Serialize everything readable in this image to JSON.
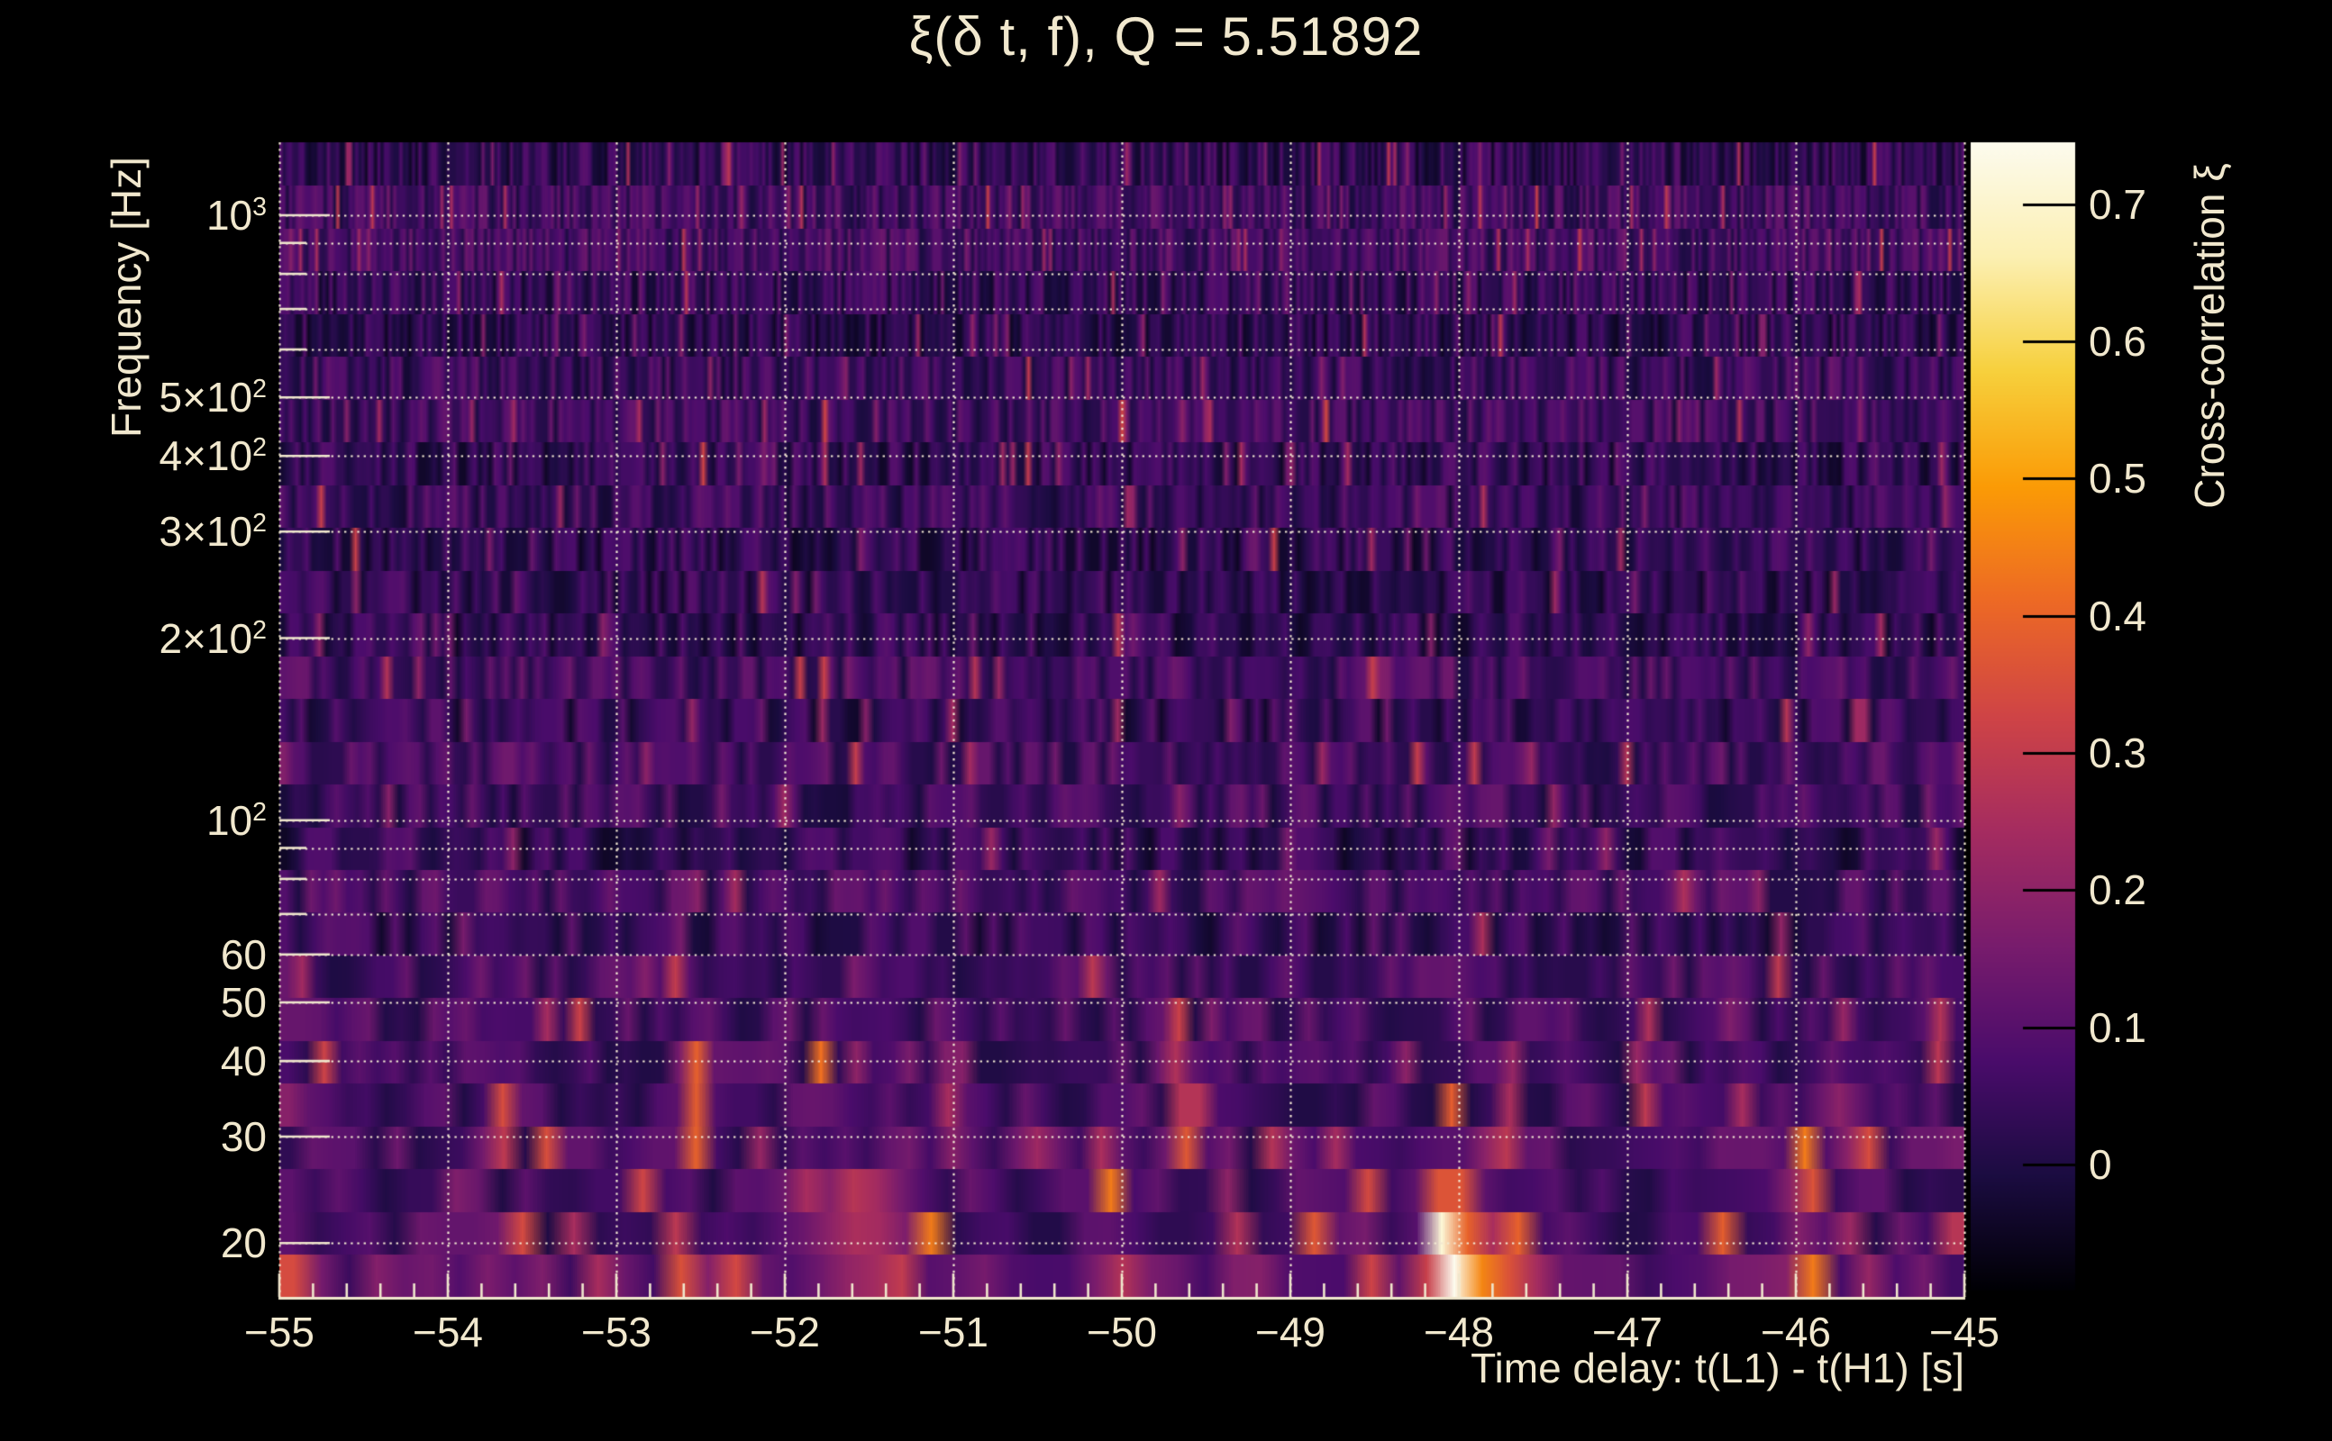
{
  "colors": {
    "background": "#000000",
    "text": "#f1e8ce",
    "axis_line": "#f0e7cd",
    "grid_dots": "#f3ead3",
    "colorbar_tick": "#000000"
  },
  "chart_data": {
    "type": "heatmap",
    "title": "ξ(δ t, f), Q = 5.51892",
    "q_value": 5.51892,
    "xlabel": "Time delay: t(L1) - t(H1) [s]",
    "ylabel": "Frequency [Hz]",
    "zlabel": "Cross-correlation ξ",
    "x_range": [
      -55,
      -45
    ],
    "x_minor_tick_step": 0.2,
    "x_ticks": [
      {
        "v": -55,
        "label": "−55"
      },
      {
        "v": -54,
        "label": "−54"
      },
      {
        "v": -53,
        "label": "−53"
      },
      {
        "v": -52,
        "label": "−52"
      },
      {
        "v": -51,
        "label": "−51"
      },
      {
        "v": -50,
        "label": "−50"
      },
      {
        "v": -49,
        "label": "−49"
      },
      {
        "v": -48,
        "label": "−48"
      },
      {
        "v": -47,
        "label": "−47"
      },
      {
        "v": -46,
        "label": "−46"
      },
      {
        "v": -45,
        "label": "−45"
      }
    ],
    "y_scale": "log",
    "y_range_hz": [
      16.3,
      1320
    ],
    "y_ticks": [
      {
        "v": 20,
        "label": "20"
      },
      {
        "v": 30,
        "label": "30"
      },
      {
        "v": 40,
        "label": "40"
      },
      {
        "v": 50,
        "label": "50"
      },
      {
        "v": 60,
        "label": "60"
      },
      {
        "v": 100,
        "label": "10",
        "sup": "2"
      },
      {
        "v": 200,
        "label": "2×10",
        "sup": "2"
      },
      {
        "v": 300,
        "label": "3×10",
        "sup": "2"
      },
      {
        "v": 400,
        "label": "4×10",
        "sup": "2"
      },
      {
        "v": 500,
        "label": "5×10",
        "sup": "2"
      },
      {
        "v": 1000,
        "label": "10",
        "sup": "3"
      }
    ],
    "y_gridlines": [
      20,
      30,
      40,
      50,
      60,
      70,
      80,
      90,
      100,
      200,
      300,
      400,
      500,
      600,
      700,
      800,
      900,
      1000
    ],
    "z_range": [
      -0.092,
      0.745
    ],
    "z_ticks": [
      {
        "v": 0.7,
        "label": "0.7"
      },
      {
        "v": 0.6,
        "label": "0.6"
      },
      {
        "v": 0.5,
        "label": "0.5"
      },
      {
        "v": 0.4,
        "label": "0.4"
      },
      {
        "v": 0.3,
        "label": "0.3"
      },
      {
        "v": 0.2,
        "label": "0.2"
      },
      {
        "v": 0.1,
        "label": "0.1"
      },
      {
        "v": 0,
        "label": "0"
      }
    ],
    "grid": {
      "style": "dotted",
      "on": true
    },
    "legend_position": "right-colorbar",
    "colormap": {
      "name": "inferno-like",
      "stops": [
        [
          0.0,
          "#000004"
        ],
        [
          0.1,
          "#1b0c41"
        ],
        [
          0.2,
          "#4a0c6b"
        ],
        [
          0.3,
          "#781c6d"
        ],
        [
          0.4,
          "#a52c60"
        ],
        [
          0.5,
          "#cf4446"
        ],
        [
          0.6,
          "#ed6925"
        ],
        [
          0.7,
          "#fb9b06"
        ],
        [
          0.8,
          "#f7d03c"
        ],
        [
          0.9,
          "#fcf0b2"
        ],
        [
          1.0,
          "#fdfbee"
        ]
      ]
    },
    "background_texture": {
      "description": "dark-purple noise floor with fine vertical striations; warmer pink/red mottling below ~45 Hz",
      "base_value_range": [
        -0.06,
        0.14
      ]
    },
    "hotspots": [
      {
        "t": -48.06,
        "f_lo": 16,
        "f_hi": 23.5,
        "value": 0.745,
        "t_sigma": 0.1,
        "note": "bright white-hot peak"
      },
      {
        "t": -48.06,
        "f_lo": 23.5,
        "f_hi": 27.5,
        "value": 0.46,
        "t_sigma": 0.13
      },
      {
        "t": -47.92,
        "f_lo": 16,
        "f_hi": 21,
        "value": 0.5,
        "t_sigma": 0.22
      },
      {
        "t": -47.65,
        "f_lo": 16,
        "f_hi": 18.7,
        "value": 0.5,
        "t_sigma": 0.09
      },
      {
        "t": -47.72,
        "f_lo": 27,
        "f_hi": 42,
        "value": 0.3,
        "t_sigma": 0.05
      },
      {
        "t": -48.55,
        "f_lo": 21,
        "f_hi": 27,
        "value": 0.32,
        "t_sigma": 0.08
      },
      {
        "t": -49.6,
        "f_lo": 27,
        "f_hi": 38,
        "value": 0.43,
        "t_sigma": 0.06
      },
      {
        "t": -50.0,
        "f_lo": 16,
        "f_hi": 20,
        "value": 0.3,
        "t_sigma": 0.15
      },
      {
        "t": -51.0,
        "f_lo": 30,
        "f_hi": 44,
        "value": 0.32,
        "t_sigma": 0.05
      },
      {
        "t": -51.27,
        "f_lo": 16,
        "f_hi": 19,
        "value": 0.33,
        "t_sigma": 0.08
      },
      {
        "t": -51.55,
        "f_lo": 17,
        "f_hi": 26,
        "value": 0.27,
        "t_sigma": 0.25
      },
      {
        "t": -52.55,
        "f_lo": 27,
        "f_hi": 45,
        "value": 0.4,
        "t_sigma": 0.06
      },
      {
        "t": -53.7,
        "f_lo": 27,
        "f_hi": 38,
        "value": 0.38,
        "t_sigma": 0.05
      },
      {
        "t": -46.35,
        "f_lo": 29,
        "f_hi": 38,
        "value": 0.28,
        "t_sigma": 0.05
      },
      {
        "t": -45.95,
        "f_lo": 21,
        "f_hi": 31,
        "value": 0.42,
        "t_sigma": 0.07
      },
      {
        "t": -45.7,
        "f_lo": 29,
        "f_hi": 38,
        "value": 0.33,
        "t_sigma": 0.05
      },
      {
        "t": -45.16,
        "f_lo": 37,
        "f_hi": 50,
        "value": 0.3,
        "t_sigma": 0.05
      }
    ],
    "render_hints": {
      "rows": 27,
      "noise_seed": 987654321
    }
  }
}
